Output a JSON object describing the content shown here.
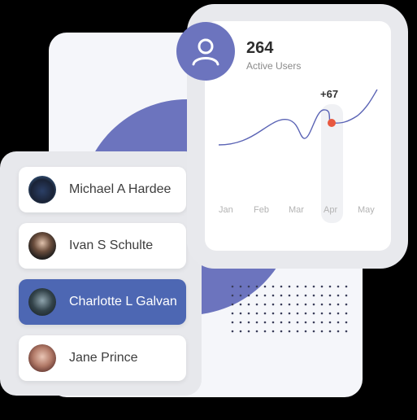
{
  "stats": {
    "active_users_value": "264",
    "active_users_label": "Active Users",
    "delta": "+67"
  },
  "months": [
    "Jan",
    "Feb",
    "Mar",
    "Apr",
    "May"
  ],
  "users": [
    {
      "name": "Michael A Hardee",
      "selected": false
    },
    {
      "name": "Ivan S Schulte",
      "selected": false
    },
    {
      "name": "Charlotte L Galvan",
      "selected": true
    },
    {
      "name": "Jane Prince",
      "selected": false
    }
  ],
  "colors": {
    "accent": "#6c74be",
    "selected_row": "#4d67b3",
    "line": "#5b64b5",
    "highlight_dot": "#e8583f"
  },
  "icons": {
    "stat_icon": "user-icon"
  }
}
